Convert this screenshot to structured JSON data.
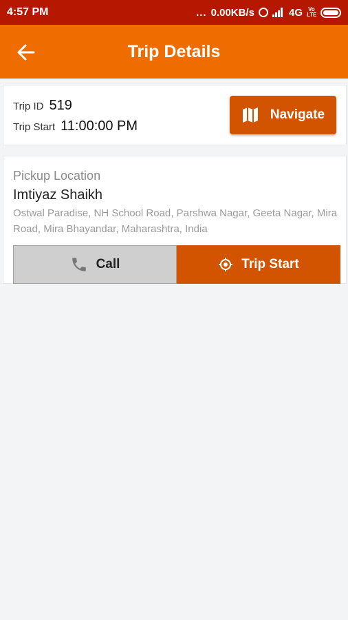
{
  "status_bar": {
    "time": "4:57 PM",
    "dots": "...",
    "network_speed": "0.00KB/s",
    "network_type": "4G",
    "volte_label": "Vo LTE"
  },
  "app_bar": {
    "title": "Trip Details",
    "back_icon": "arrow-left-icon"
  },
  "trip": {
    "id_label": "Trip ID",
    "id_value": "519",
    "start_label": "Trip Start",
    "start_value": "11:00:00 PM",
    "navigate_label": "Navigate",
    "navigate_icon": "map-icon"
  },
  "pickup": {
    "label": "Pickup Location",
    "name": "Imtiyaz Shaikh",
    "address": "Ostwal Paradise, NH School Road, Parshwa Nagar, Geeta Nagar, Mira Road, Mira Bhayandar, Maharashtra, India",
    "call_label": "Call",
    "call_icon": "phone-icon",
    "trip_start_label": "Trip Start",
    "trip_start_icon": "target-icon"
  },
  "colors": {
    "status_bar": "#b51700",
    "app_bar": "#ef6c00",
    "accent_button": "#d35400",
    "call_button": "#cfcfcf"
  }
}
